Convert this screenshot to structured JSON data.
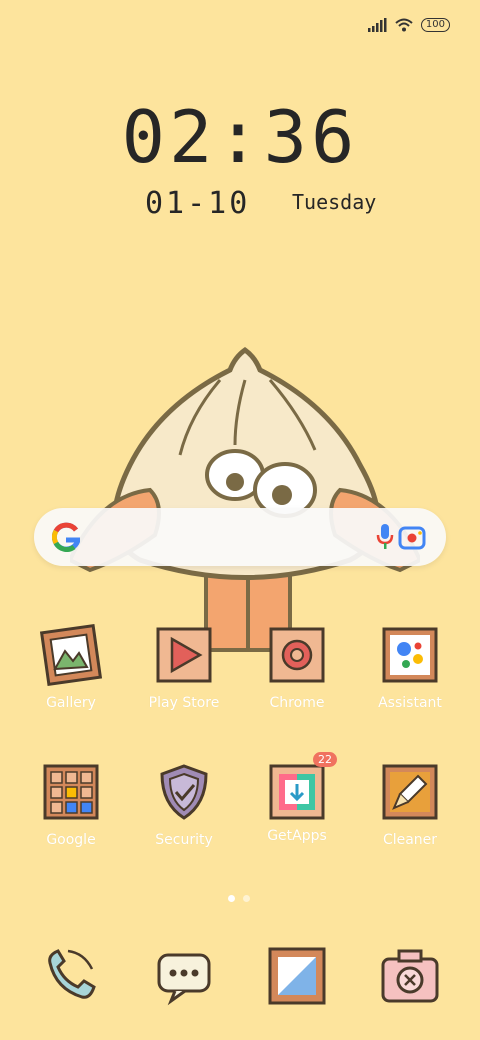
{
  "status_bar": {
    "battery": "100",
    "icons": [
      "signal-icon",
      "wifi-icon",
      "battery-icon"
    ]
  },
  "clock": {
    "time": "02:36",
    "date": "01-10",
    "weekday": "Tuesday"
  },
  "search_bar": {
    "icons": [
      "google-logo-icon",
      "microphone-icon",
      "lens-camera-icon"
    ]
  },
  "apps_row1": [
    {
      "label": "Gallery",
      "icon": "gallery-icon"
    },
    {
      "label": "Play Store",
      "icon": "play-store-icon"
    },
    {
      "label": "Chrome",
      "icon": "chrome-icon"
    },
    {
      "label": "Assistant",
      "icon": "assistant-icon"
    }
  ],
  "apps_row2": [
    {
      "label": "Google",
      "icon": "google-folder-icon"
    },
    {
      "label": "Security",
      "icon": "security-icon"
    },
    {
      "label": "GetApps",
      "icon": "getapps-icon",
      "badge": "22"
    },
    {
      "label": "Cleaner",
      "icon": "cleaner-icon"
    }
  ],
  "dock": [
    {
      "icon": "phone-icon"
    },
    {
      "icon": "messages-icon"
    },
    {
      "icon": "browser-icon"
    },
    {
      "icon": "camera-icon"
    }
  ],
  "page_indicator": {
    "pages": 2,
    "current": 1
  },
  "colors": {
    "background": "#fde49d",
    "label": "#ffffff",
    "badge": "#f0725f"
  }
}
